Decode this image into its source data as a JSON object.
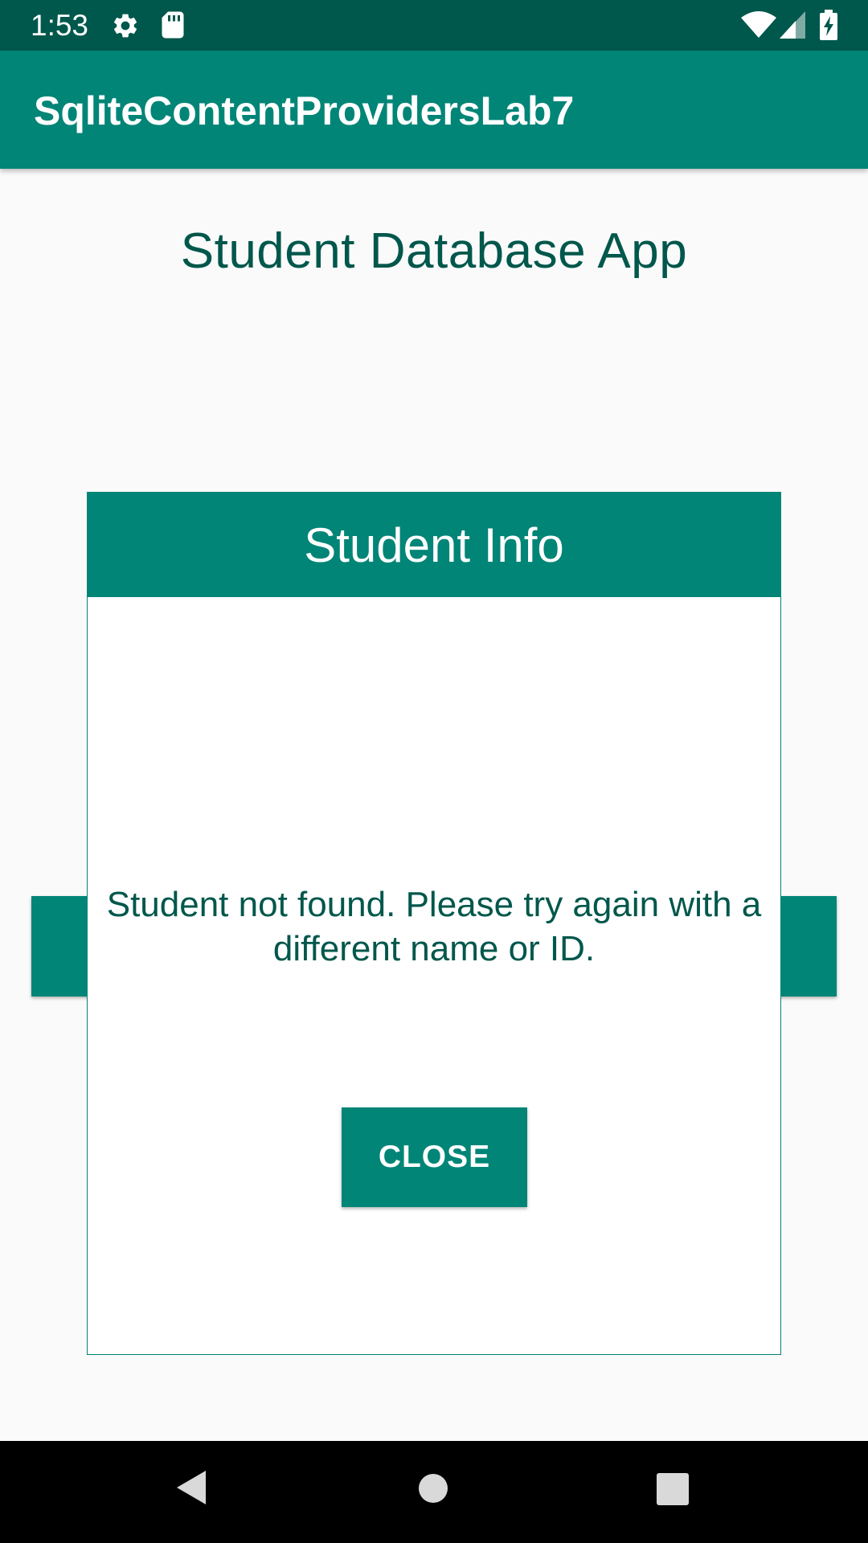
{
  "status_bar": {
    "time": "1:53",
    "icons": [
      "gear-icon",
      "sd-card-icon",
      "wifi-icon",
      "signal-icon",
      "battery-charging-icon"
    ]
  },
  "app_bar": {
    "title": "SqliteContentProvidersLab7"
  },
  "main": {
    "heading": "Student Database App"
  },
  "dialog": {
    "title": "Student Info",
    "message": "Student not found. Please try again with a different name or ID.",
    "close_label": "CLOSE"
  },
  "nav_bar": {
    "icons": [
      "back-icon",
      "home-icon",
      "recents-icon"
    ]
  },
  "colors": {
    "primary": "#008577",
    "primary_dark": "#00574b",
    "background": "#fafafa"
  }
}
